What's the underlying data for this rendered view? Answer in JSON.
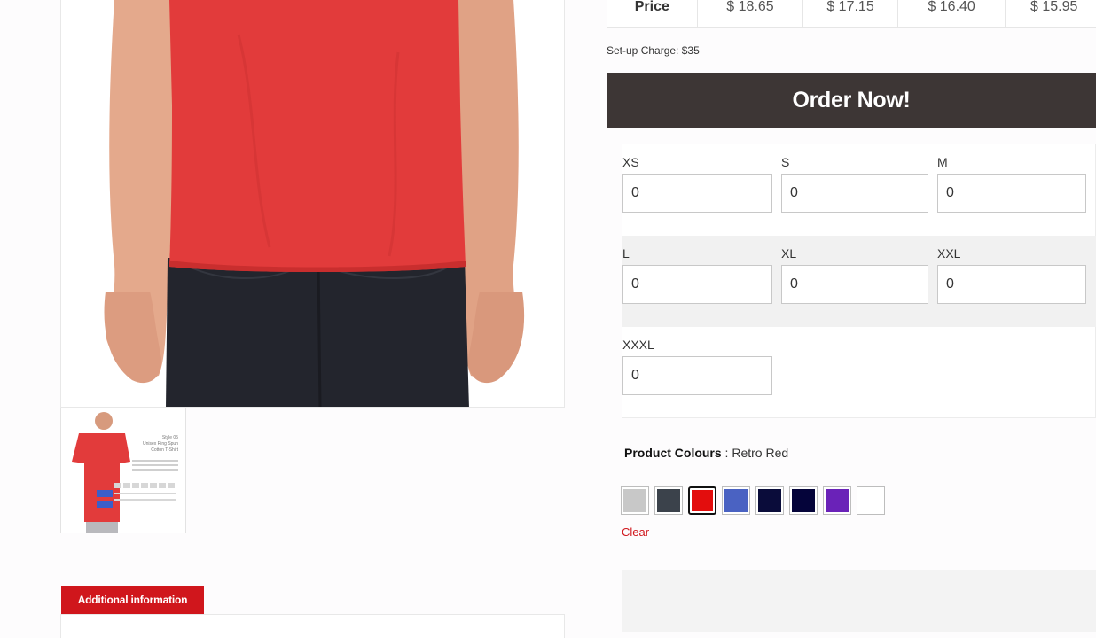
{
  "price_table": {
    "header": "Price",
    "prices": [
      "$ 18.65",
      "$ 17.15",
      "$ 16.40",
      "$ 15.95"
    ]
  },
  "setup_charge": "Set-up Charge: $35",
  "order_button": "Order Now!",
  "sizes": [
    {
      "label": "XS",
      "value": "0"
    },
    {
      "label": "S",
      "value": "0"
    },
    {
      "label": "M",
      "value": "0"
    },
    {
      "label": "L",
      "value": "0"
    },
    {
      "label": "XL",
      "value": "0"
    },
    {
      "label": "XXL",
      "value": "0"
    },
    {
      "label": "XXXL",
      "value": "0"
    }
  ],
  "colours": {
    "label": "Product Colours",
    "separator": " : ",
    "selected": "Retro Red",
    "swatches": [
      "#c8c8c8",
      "#3b424b",
      "#e30d0d",
      "#4a62c2",
      "#0a0c3a",
      "#05043a",
      "#6a22b8",
      "#ffffff"
    ],
    "selected_index": 2,
    "clear_label": "Clear"
  },
  "tabs": {
    "additional_information": "Additional information"
  },
  "colors": {
    "accent": "#d0161c",
    "order_button_bg": "#3d3635",
    "shirt": "#e03c3c"
  },
  "thumbnail": {
    "style": "Style 05",
    "name_lines": [
      "Unisex Ring Spun",
      "Cotton T-Shirt"
    ]
  }
}
